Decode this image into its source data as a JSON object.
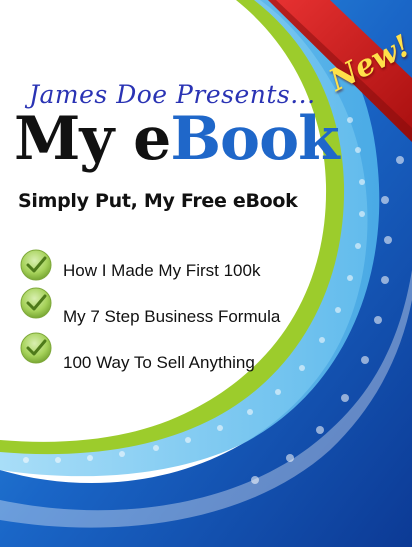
{
  "cover": {
    "presenter": "James Doe Presents...",
    "title_part1": "My e",
    "title_part2": "Book",
    "subtitle": "Simply Put, My Free eBook",
    "badge": "New!",
    "bullets": [
      {
        "icon": "check-icon",
        "text": "How I Made My First 100k"
      },
      {
        "icon": "check-icon",
        "text": "My 7 Step Business Formula"
      },
      {
        "icon": "check-icon",
        "text": "100 Way To Sell Anything"
      }
    ]
  },
  "colors": {
    "presenter": "#2a33b4",
    "title_dark": "#111111",
    "title_blue": "#1f67c9",
    "ribbon_red": "#d21c1c",
    "badge_yellow": "#ffe14a",
    "swirl_blue": "#1a66c7",
    "swirl_green": "#9ccc2c",
    "check_green": "#8fc23f"
  }
}
